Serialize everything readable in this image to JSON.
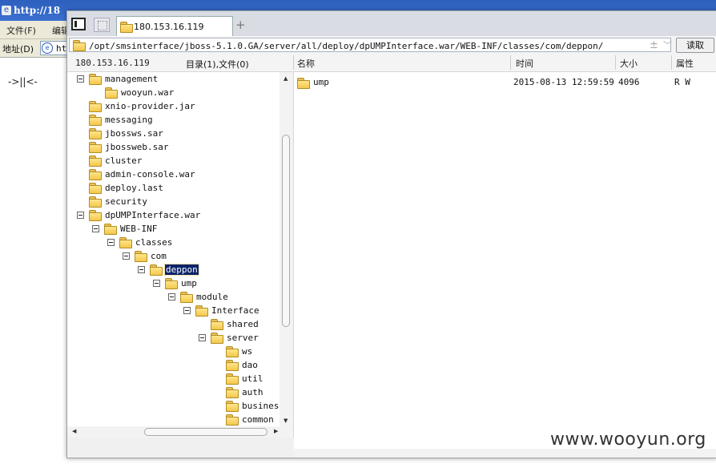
{
  "browser": {
    "title_fragment": "http://18",
    "menu": [
      "文件(F)",
      "编辑"
    ],
    "address_label": "地址(D)",
    "address_value": "ht",
    "page_text": "->||<-"
  },
  "file_manager": {
    "tab_title": "180.153.16.119",
    "tab_add": "+",
    "path": "/opt/smsinterface/jboss-5.1.0.GA/server/all/deploy/dpUMPInterface.war/WEB-INF/classes/com/deppon/",
    "path_add": "±",
    "path_dropdown": "﹀",
    "read_button": "读取",
    "host": "180.153.16.119",
    "count_text": "目录(1),文件(0)",
    "columns": {
      "name": "名称",
      "time": "时间",
      "size": "大小",
      "attr": "属性"
    },
    "tree": [
      {
        "label": "management",
        "toggle": true
      },
      {
        "label": "wooyun.war",
        "toggle": false
      },
      {
        "label": "xnio-provider.jar",
        "toggle": false
      },
      {
        "label": "messaging",
        "toggle": false
      },
      {
        "label": "jbossws.sar",
        "toggle": false
      },
      {
        "label": "jbossweb.sar",
        "toggle": false
      },
      {
        "label": "cluster",
        "toggle": false
      },
      {
        "label": "admin-console.war",
        "toggle": false
      },
      {
        "label": "deploy.last",
        "toggle": false
      },
      {
        "label": "security",
        "toggle": false
      },
      {
        "label": "dpUMPInterface.war",
        "toggle": true
      },
      {
        "label": "WEB-INF",
        "toggle": true
      },
      {
        "label": "classes",
        "toggle": true
      },
      {
        "label": "com",
        "toggle": true
      },
      {
        "label": "deppon",
        "toggle": true,
        "selected": true
      },
      {
        "label": "ump",
        "toggle": true
      },
      {
        "label": "module",
        "toggle": true
      },
      {
        "label": "Interface",
        "toggle": true
      },
      {
        "label": "shared",
        "toggle": false
      },
      {
        "label": "server",
        "toggle": true
      },
      {
        "label": "ws",
        "toggle": false
      },
      {
        "label": "dao",
        "toggle": false
      },
      {
        "label": "util",
        "toggle": false
      },
      {
        "label": "auth",
        "toggle": false
      },
      {
        "label": "business",
        "toggle": false
      },
      {
        "label": "common",
        "toggle": false
      }
    ],
    "files": [
      {
        "name": "ump",
        "time": "2015-08-13 12:59:59",
        "size": "4096",
        "attr": "R W"
      }
    ]
  },
  "watermark": "www.wooyun.org",
  "colors": {
    "selection": "#0a246a",
    "folder": "#f3c84d",
    "titlebar": "#2d5fbd"
  }
}
